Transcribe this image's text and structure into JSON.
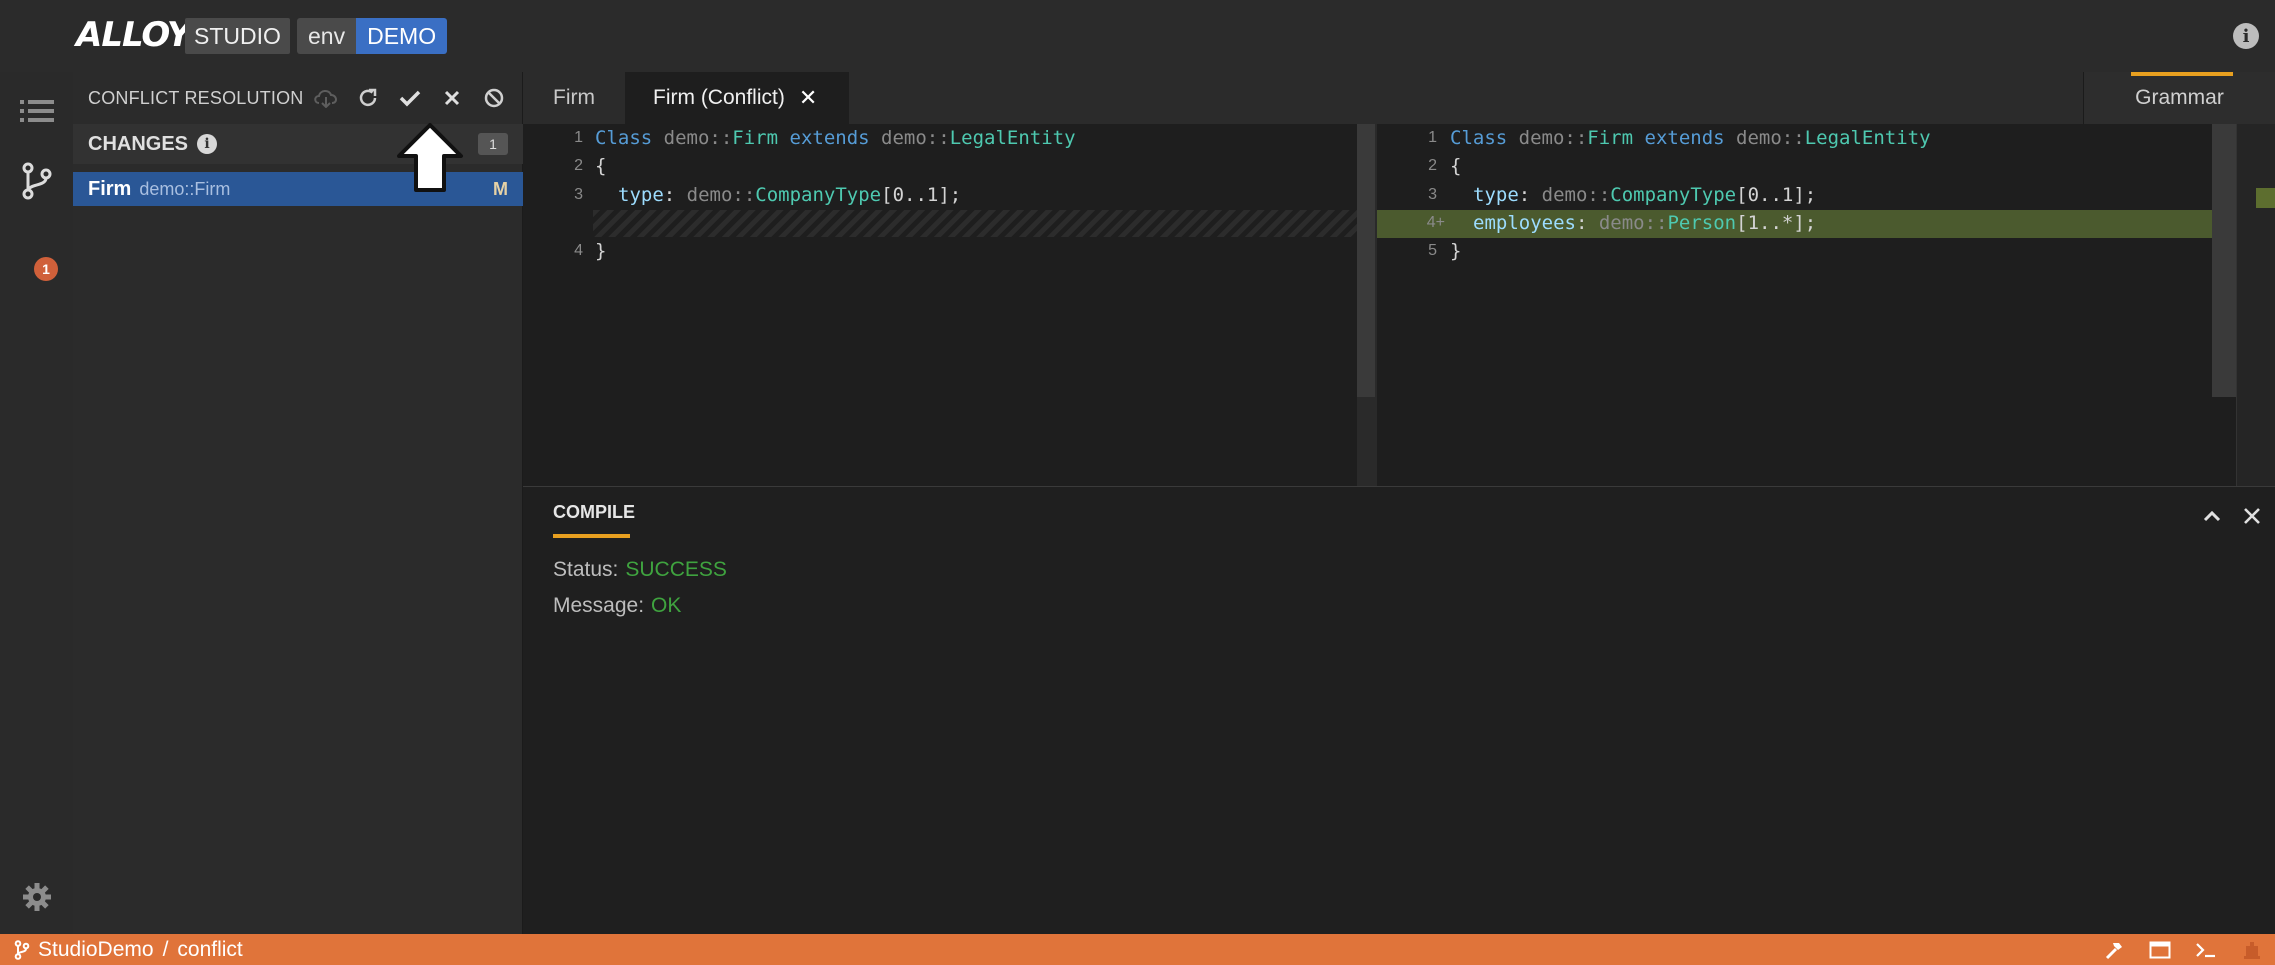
{
  "header": {
    "logo_text": "ALLOY",
    "studio_label": "STUDIO",
    "env_label": "env",
    "env_value": "DEMO",
    "info_icon": "info-circle-icon"
  },
  "activity_bar": {
    "items": [
      {
        "icon": "list-icon"
      },
      {
        "icon": "git-branch-icon",
        "badge": "1"
      }
    ],
    "settings_icon": "gear-icon"
  },
  "side_panel": {
    "title": "CONFLICT RESOLUTION",
    "tools": [
      "cloud-download-icon",
      "refresh-icon",
      "check-icon",
      "close-icon",
      "block-icon"
    ],
    "changes_title": "CHANGES",
    "changes_count": "1",
    "changes": [
      {
        "name": "Firm",
        "path": "demo::Firm",
        "type": "M"
      }
    ]
  },
  "tabs": [
    {
      "label": "Firm"
    },
    {
      "label": "Firm (Conflict)",
      "close": "✕"
    }
  ],
  "grammar_tab": "Grammar",
  "editor_left": {
    "line_numbers": [
      "1",
      "2",
      "3",
      "4"
    ],
    "line_1": {
      "kw1": "Class",
      "pkg1": "demo::",
      "name": "Firm",
      "kw2": "extends",
      "pkg2": "demo::",
      "parent": "LegalEntity"
    },
    "line_2": "{",
    "line_3": {
      "prop": "type",
      "colon": ": ",
      "pkg": "demo::",
      "type": "CompanyType",
      "mult": "[0..1];"
    },
    "line_4": "}"
  },
  "editor_right": {
    "line_numbers": [
      "1",
      "2",
      "3",
      "4+",
      "5"
    ],
    "line_1": {
      "kw1": "Class",
      "pkg1": "demo::",
      "name": "Firm",
      "kw2": "extends",
      "pkg2": "demo::",
      "parent": "LegalEntity"
    },
    "line_2": "{",
    "line_3": {
      "prop": "type",
      "colon": ": ",
      "pkg": "demo::",
      "type": "CompanyType",
      "mult": "[0..1];"
    },
    "line_4": {
      "prop": "employees",
      "colon": ": ",
      "pkg": "demo::",
      "type": "Person",
      "mult": "[1..*];"
    },
    "line_5": "}"
  },
  "compile_panel": {
    "tab": "COMPILE",
    "status_label": "Status:",
    "status_value": "SUCCESS",
    "message_label": "Message:",
    "message_value": "OK",
    "status_color": "#3fa33f"
  },
  "status_bar": {
    "project": "StudioDemo",
    "separator": "/",
    "branch": "conflict",
    "color": "#e0743a",
    "right_icons": [
      "hammer-icon",
      "window-icon",
      "terminal-icon",
      "robot-icon"
    ]
  }
}
